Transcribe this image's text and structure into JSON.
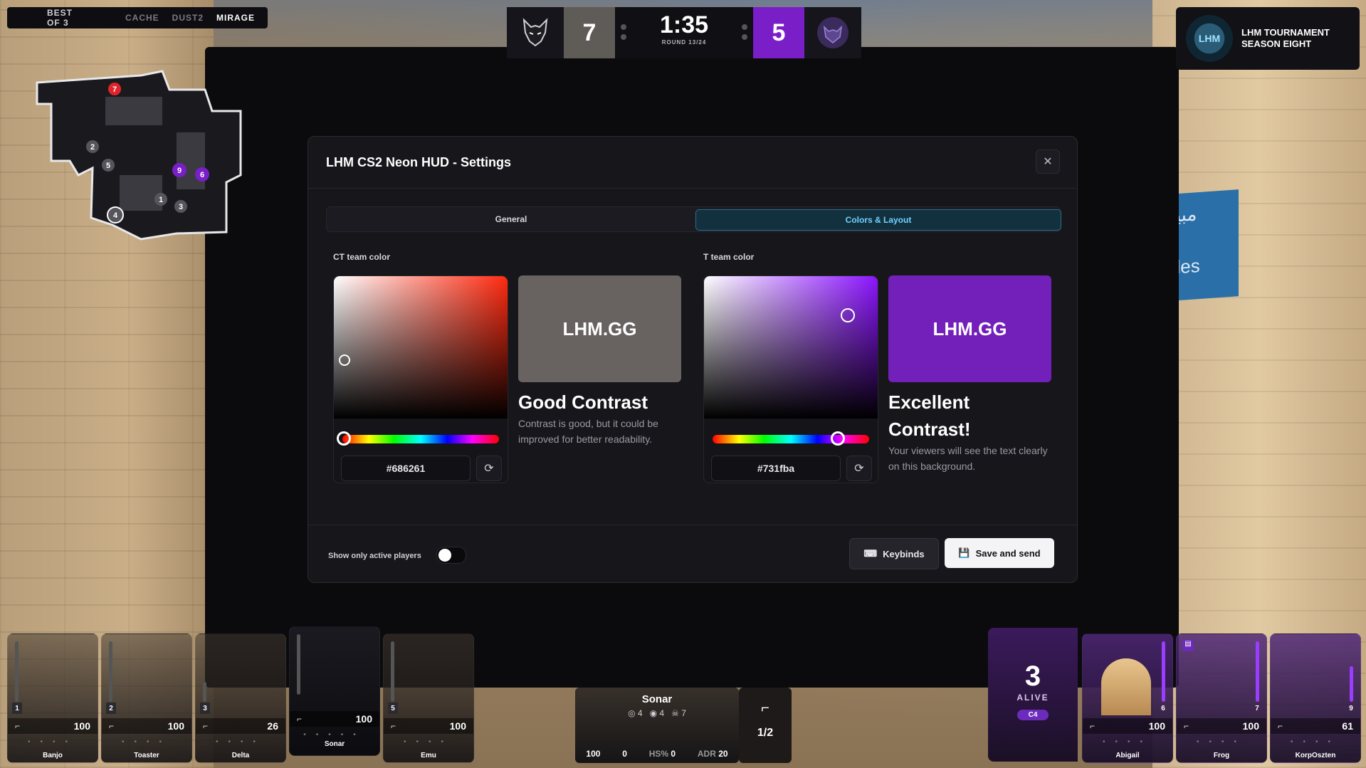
{
  "series": {
    "label": "BEST OF 3",
    "maps": [
      "CACHE",
      "DUST2",
      "MIRAGE"
    ]
  },
  "scoreboard": {
    "ct_score": "7",
    "t_score": "5",
    "time": "1:35",
    "round": "ROUND 13/24"
  },
  "tournament": {
    "badge": "LHM",
    "line1": "LHM TOURNAMENT",
    "line2": "SEASON EIGHT"
  },
  "minimap": {
    "markers": [
      "7",
      "2",
      "5",
      "9",
      "6",
      "1",
      "3",
      "4"
    ]
  },
  "modal": {
    "title": "LHM CS2 Neon HUD - Settings",
    "tabs": [
      "General",
      "Colors & Layout"
    ],
    "active_tab": "Colors & Layout",
    "ct": {
      "label": "CT team color",
      "hex": "#686261",
      "color": "#686261",
      "preview_text": "LHM.GG",
      "contrast_title": "Good Contrast",
      "contrast_desc": "Contrast is good, but it could be improved for better readability."
    },
    "t": {
      "label": "T team color",
      "hex": "#731fba",
      "color": "#731fba",
      "preview_text": "LHM.GG",
      "contrast_title": "Excellent Contrast!",
      "contrast_desc": "Your viewers will see the text clearly on this background."
    },
    "toggle_label": "Show only active players",
    "toggle_on": false,
    "keybinds_label": "Keybinds",
    "save_label": "Save and send"
  },
  "ct_players": [
    {
      "slot": "1",
      "hp": "100",
      "name": "Banjo"
    },
    {
      "slot": "2",
      "hp": "100",
      "name": "Toaster"
    },
    {
      "slot": "3",
      "hp": "26",
      "name": "Delta"
    },
    {
      "slot": "",
      "hp": "100",
      "name": "Sonar"
    },
    {
      "slot": "5",
      "hp": "100",
      "name": "Emu"
    }
  ],
  "observed": {
    "name": "Sonar",
    "kills": "4",
    "assists": "4",
    "deaths": "7",
    "hp": "100",
    "armor": "0",
    "hs_label": "HS%",
    "hs": "0",
    "adr_label": "ADR",
    "adr": "20",
    "ammo": "1/2"
  },
  "alive": {
    "count": "3",
    "label": "ALIVE",
    "c4": "C4"
  },
  "t_players": [
    {
      "slot": "6",
      "hp": "100",
      "name": "Abigail"
    },
    {
      "slot": "7",
      "hp": "100",
      "name": "Frog"
    },
    {
      "slot": "9",
      "hp": "61",
      "name": "KorpOszten"
    }
  ],
  "background_sign": "مبيع\ns\nales"
}
